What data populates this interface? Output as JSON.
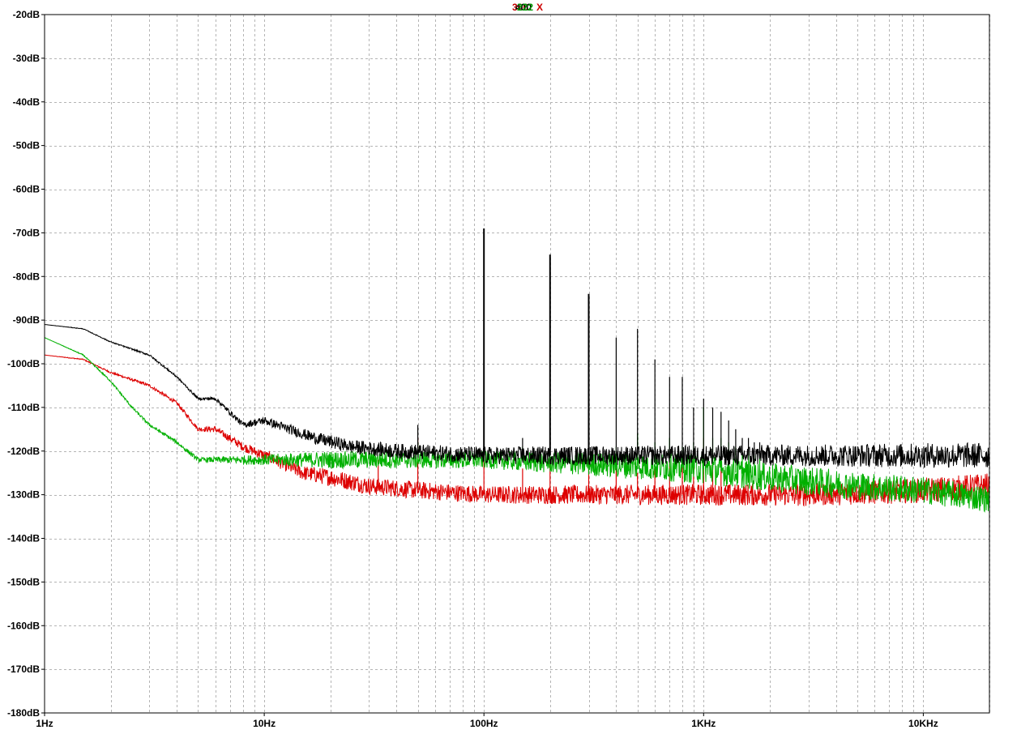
{
  "chart_data": {
    "type": "line",
    "x_scale": "log",
    "xlim": [
      1,
      20000
    ],
    "ylim": [
      -180,
      -20
    ],
    "grid": true,
    "background_color": "#ffffff",
    "header_labels": [
      {
        "text": "300",
        "color": "#c00000"
      },
      {
        "text": "400",
        "color": "#000000"
      },
      {
        "text": "222",
        "color": "#009900"
      },
      {
        "text": "X",
        "color": "#cc0000"
      }
    ],
    "y_ticks": [
      -20,
      -30,
      -40,
      -50,
      -60,
      -70,
      -80,
      -90,
      -100,
      -110,
      -120,
      -130,
      -140,
      -150,
      -160,
      -170,
      -180
    ],
    "y_tick_labels": [
      "-20dB",
      "-30dB",
      "-40dB",
      "-50dB",
      "-60dB",
      "-70dB",
      "-80dB",
      "-90dB",
      "-100dB",
      "-110dB",
      "-120dB",
      "-130dB",
      "-140dB",
      "-150dB",
      "-160dB",
      "-170dB",
      "-180dB"
    ],
    "x_ticks": [
      1,
      10,
      100,
      1000,
      10000
    ],
    "x_tick_labels": [
      "1Hz",
      "10Hz",
      "100Hz",
      "1KHz",
      "10KHz"
    ],
    "series": [
      {
        "color": "#000000",
        "noise_floor": [
          [
            1,
            -91
          ],
          [
            1.5,
            -92
          ],
          [
            2,
            -95
          ],
          [
            3,
            -98
          ],
          [
            4,
            -103
          ],
          [
            5,
            -108
          ],
          [
            6,
            -108
          ],
          [
            8,
            -114
          ],
          [
            10,
            -113
          ],
          [
            13,
            -115
          ],
          [
            17,
            -117
          ],
          [
            25,
            -119
          ],
          [
            40,
            -120
          ],
          [
            100,
            -121
          ],
          [
            300,
            -121
          ],
          [
            1000,
            -121
          ],
          [
            3000,
            -121
          ],
          [
            10000,
            -121
          ],
          [
            20000,
            -121
          ]
        ],
        "noise_amplitude": [
          [
            1,
            0
          ],
          [
            5,
            0.3
          ],
          [
            20,
            1.5
          ],
          [
            100,
            2
          ],
          [
            3000,
            2.5
          ],
          [
            20000,
            3
          ]
        ],
        "spikes": [
          [
            50,
            -114
          ],
          [
            100,
            -69
          ],
          [
            150,
            -117
          ],
          [
            200,
            -75
          ],
          [
            300,
            -84
          ],
          [
            400,
            -94
          ],
          [
            500,
            -92
          ],
          [
            600,
            -99
          ],
          [
            700,
            -103
          ],
          [
            800,
            -103
          ],
          [
            900,
            -110
          ],
          [
            1000,
            -108
          ],
          [
            1100,
            -110
          ],
          [
            1200,
            -111
          ],
          [
            1300,
            -113
          ],
          [
            1400,
            -115
          ],
          [
            1500,
            -117
          ],
          [
            1600,
            -117
          ],
          [
            1700,
            -118
          ],
          [
            1800,
            -118
          ]
        ]
      },
      {
        "color": "#00b000",
        "noise_floor": [
          [
            1,
            -94
          ],
          [
            1.5,
            -98
          ],
          [
            2,
            -104
          ],
          [
            2.5,
            -110
          ],
          [
            3,
            -114
          ],
          [
            4,
            -118
          ],
          [
            5,
            -122
          ],
          [
            6,
            -122
          ],
          [
            8,
            -122
          ],
          [
            10,
            -122
          ],
          [
            20,
            -122
          ],
          [
            50,
            -122
          ],
          [
            100,
            -122
          ],
          [
            300,
            -123
          ],
          [
            1000,
            -124
          ],
          [
            2000,
            -126
          ],
          [
            5000,
            -128
          ],
          [
            10000,
            -129
          ],
          [
            20000,
            -131
          ]
        ],
        "noise_amplitude": [
          [
            1,
            0
          ],
          [
            5,
            0.5
          ],
          [
            20,
            2
          ],
          [
            100,
            2
          ],
          [
            1000,
            3.5
          ],
          [
            20000,
            3
          ]
        ],
        "spikes": [
          [
            50,
            -118
          ],
          [
            100,
            -113
          ],
          [
            150,
            -119
          ],
          [
            200,
            -119
          ],
          [
            300,
            -116
          ],
          [
            400,
            -119
          ],
          [
            500,
            -116
          ],
          [
            600,
            -118
          ],
          [
            700,
            -117
          ],
          [
            800,
            -119
          ],
          [
            900,
            -118
          ],
          [
            1000,
            -110
          ],
          [
            1100,
            -117
          ],
          [
            1200,
            -117
          ],
          [
            1300,
            -118
          ],
          [
            1400,
            -119
          ],
          [
            1500,
            -120
          ],
          [
            1600,
            -120
          ],
          [
            1700,
            -121
          ],
          [
            1800,
            -121
          ]
        ]
      },
      {
        "color": "#dd0000",
        "noise_floor": [
          [
            1,
            -98
          ],
          [
            1.5,
            -99
          ],
          [
            2,
            -102
          ],
          [
            3,
            -105
          ],
          [
            4,
            -109
          ],
          [
            5,
            -115
          ],
          [
            6,
            -115
          ],
          [
            8,
            -119
          ],
          [
            10,
            -121
          ],
          [
            15,
            -125
          ],
          [
            20,
            -126
          ],
          [
            30,
            -128
          ],
          [
            50,
            -129
          ],
          [
            100,
            -130
          ],
          [
            300,
            -130
          ],
          [
            1000,
            -130
          ],
          [
            3000,
            -130
          ],
          [
            10000,
            -129
          ],
          [
            20000,
            -128
          ]
        ],
        "noise_amplitude": [
          [
            1,
            0
          ],
          [
            5,
            0.5
          ],
          [
            20,
            2
          ],
          [
            100,
            2
          ],
          [
            20000,
            3
          ]
        ],
        "spikes": [
          [
            33,
            -122
          ],
          [
            50,
            -117
          ],
          [
            100,
            -113
          ],
          [
            150,
            -124
          ],
          [
            200,
            -122
          ],
          [
            300,
            -124
          ],
          [
            400,
            -124
          ],
          [
            500,
            -125
          ],
          [
            600,
            -124
          ],
          [
            700,
            -122
          ],
          [
            800,
            -123
          ],
          [
            900,
            -121
          ],
          [
            1000,
            -117
          ],
          [
            1100,
            -123
          ],
          [
            1200,
            -124
          ]
        ]
      }
    ]
  }
}
